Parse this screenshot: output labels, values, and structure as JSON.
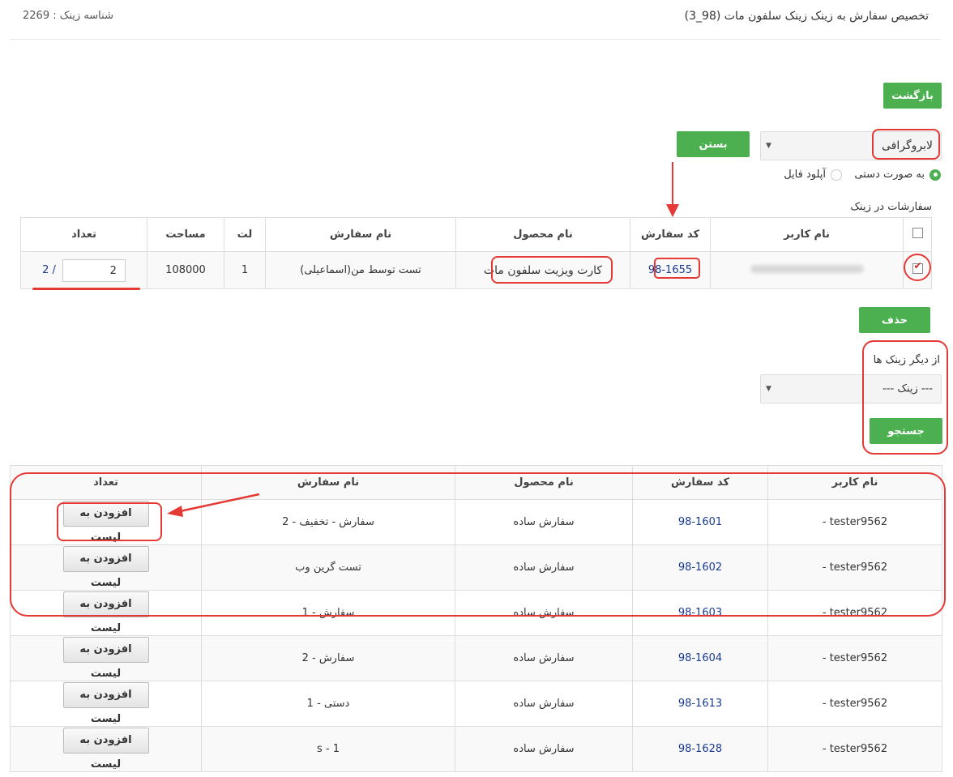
{
  "header": {
    "title": "تخصیص سفارش به زینک زینک سلفون مات (98_3)",
    "zinc_id": "شناسه زینک : 2269"
  },
  "back_button": "بازگشت",
  "machine_select": {
    "value": "لابروگرافی"
  },
  "close_button": "بستن",
  "mode": {
    "manual": "به صورت دستی",
    "upload": "آپلود فایل",
    "selected": "manual"
  },
  "zinc_orders": {
    "title": "سفارشات در زینک",
    "columns": [
      "نام کاربر",
      "کد سفارش",
      "نام محصول",
      "نام سفارش",
      "لت",
      "مساحت",
      "تعداد"
    ],
    "rows": [
      {
        "user": "",
        "code": "98-1655",
        "product": "کارت ویزیت سلفون مات",
        "order_name": "تست توسط من(اسماعیلی)",
        "lat": "1",
        "area": "108000",
        "qty_value": "2",
        "qty_total": "2 /",
        "checked": true
      }
    ]
  },
  "delete_button": "حذف",
  "other_zincs": {
    "label": "از دیگر زینک ها",
    "select_value": "--- زینک ---"
  },
  "search_button": "جستجو",
  "available_orders": {
    "columns": [
      "نام کاربر",
      "کد سفارش",
      "نام محصول",
      "نام سفارش",
      "تعداد"
    ],
    "add_label": "افزودن به لیست",
    "rows": [
      {
        "user": "tester9562 -",
        "code": "98-1601",
        "product": "سفارش ساده",
        "name": "سفارش - تخفیف - 2"
      },
      {
        "user": "tester9562 -",
        "code": "98-1602",
        "product": "سفارش ساده",
        "name": "تست گرین وب"
      },
      {
        "user": "tester9562 -",
        "code": "98-1603",
        "product": "سفارش ساده",
        "name": "سفارش - 1"
      },
      {
        "user": "tester9562 -",
        "code": "98-1604",
        "product": "سفارش ساده",
        "name": "سفارش - 2"
      },
      {
        "user": "tester9562 -",
        "code": "98-1613",
        "product": "سفارش ساده",
        "name": "دستی - 1"
      },
      {
        "user": "tester9562 -",
        "code": "98-1628",
        "product": "سفارش ساده",
        "name": "s - 1"
      }
    ]
  },
  "colors": {
    "accent": "#4caf50",
    "annotation": "#e53935",
    "link": "#1a3b8f"
  }
}
